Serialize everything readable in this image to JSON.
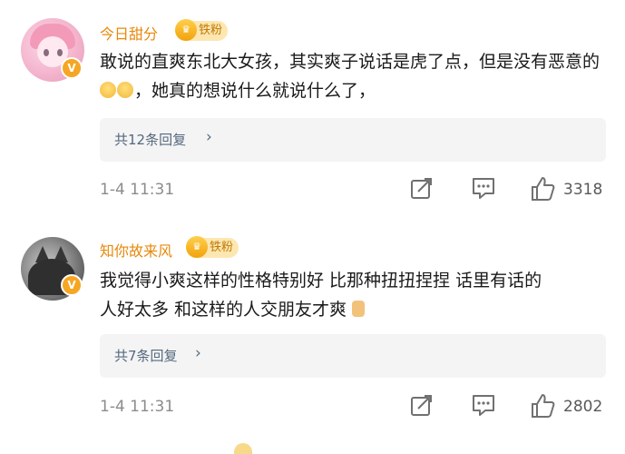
{
  "comments": [
    {
      "username": "今日甜分",
      "fan_badge": "铁粉",
      "text_before_emoji": "敢说的直爽东北大女孩，其实爽子说话是虎了点，但是没有恶意的",
      "text_after_emoji": "，她真的想说什么就说什么了，",
      "emojis": [
        "laugh-cry-emoji",
        "laugh-cry-emoji"
      ],
      "reply_label": "共12条回复",
      "time": "1-4 11:31",
      "likes": "3318"
    },
    {
      "username": "知你故来风",
      "fan_badge": "铁粉",
      "text_line1": "我觉得小爽这样的性格特别好 比那种扭扭捏捏 话里有话的",
      "text_line2": "人好太多 和这样的人交朋友才爽",
      "emojis": [
        "thumbs-up-emoji"
      ],
      "reply_label": "共7条回复",
      "time": "1-4 11:31",
      "likes": "2802"
    }
  ],
  "colors": {
    "username": "#e8880a",
    "reply_link": "#55687f",
    "meta": "#8c8c8c",
    "reply_bg": "#f4f4f4",
    "fan_badge_bg": "#fde7b1"
  }
}
